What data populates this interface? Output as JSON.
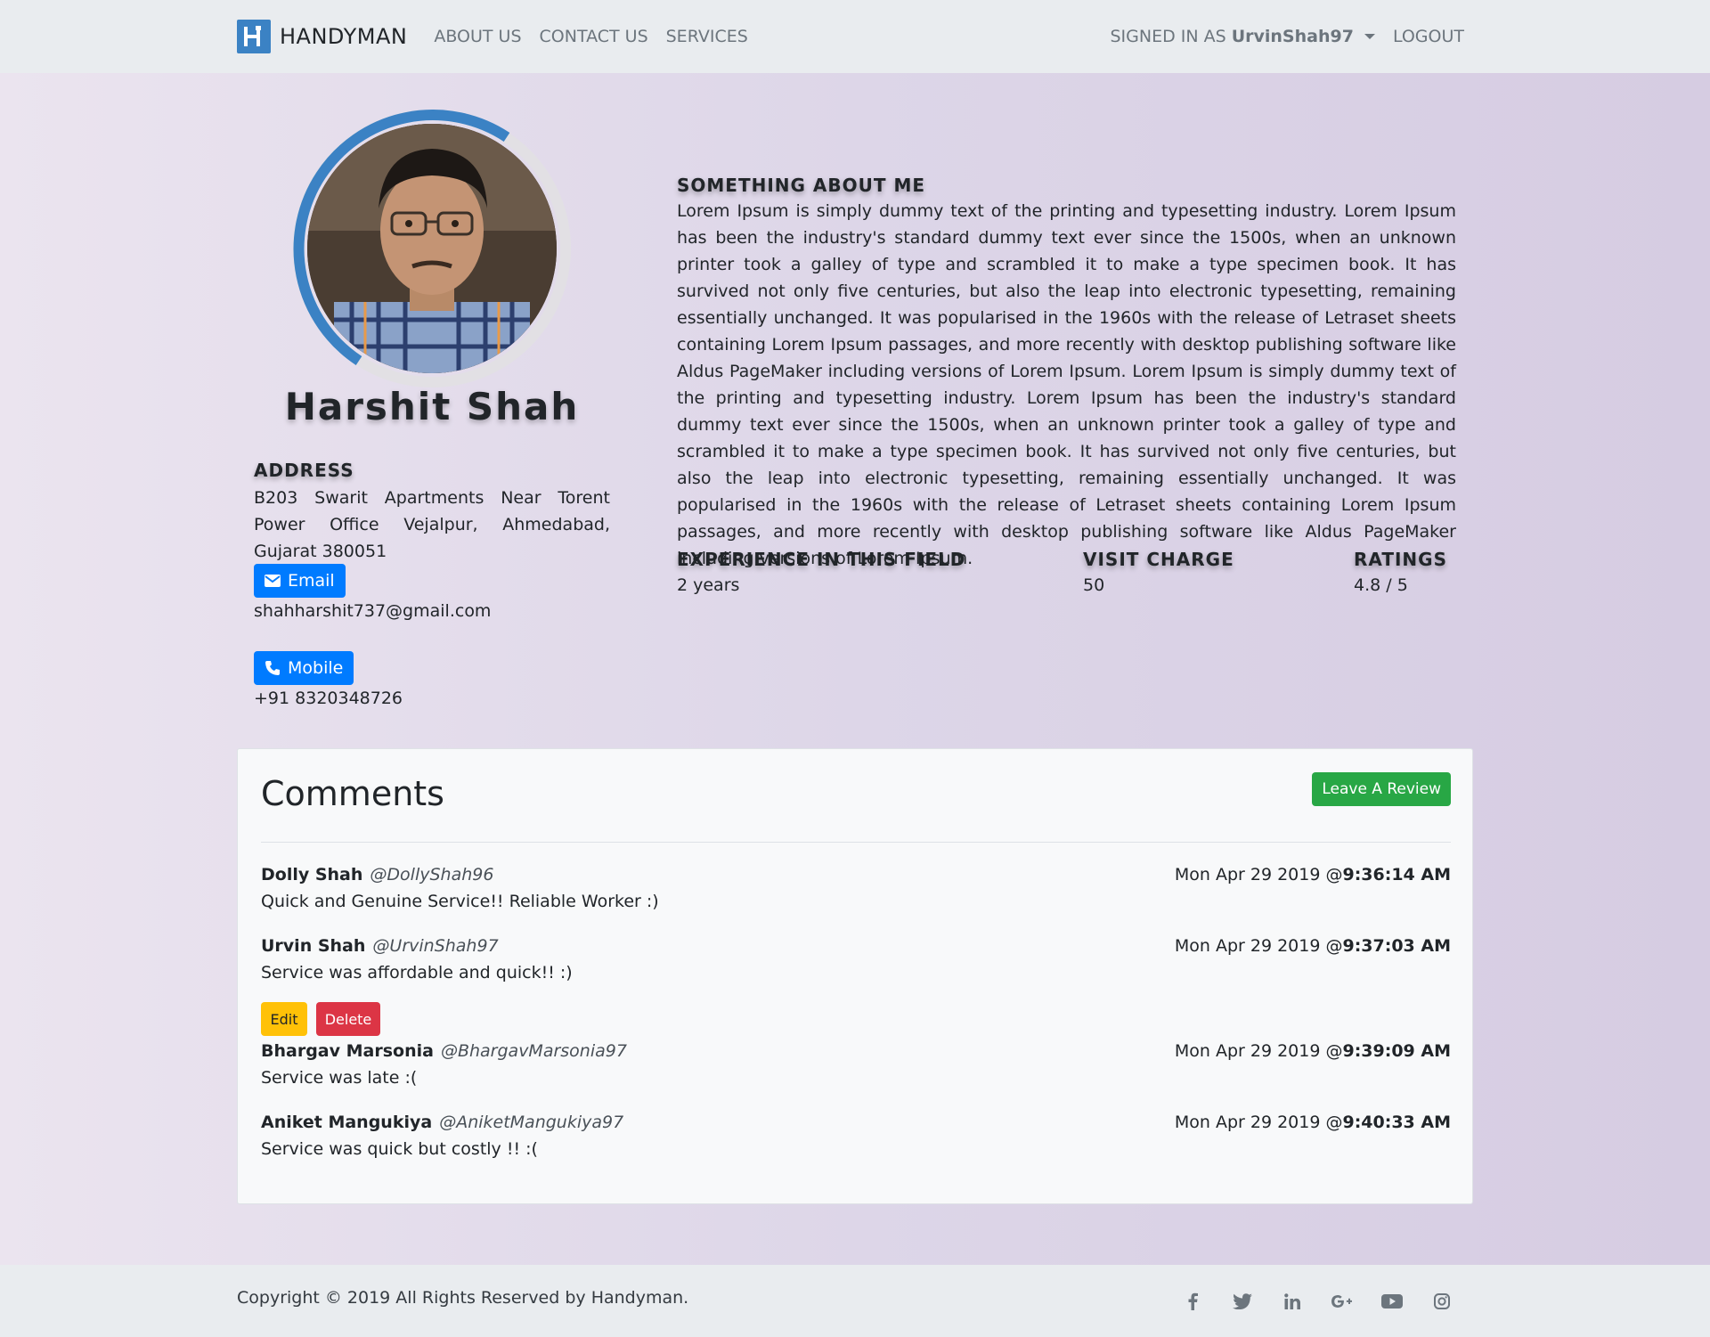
{
  "navbar": {
    "brand": "HANDYMAN",
    "links": [
      "ABOUT US",
      "CONTACT US",
      "SERVICES"
    ],
    "signed_prefix": "SIGNED IN AS",
    "signed_user": "UrvinShah97",
    "logout": "LOGOUT"
  },
  "profile": {
    "name": "Harshit Shah",
    "address_heading": "ADDRESS",
    "address": "B203 Swarit Apartments Near Torent Power Office Vejalpur, Ahmedabad, Gujarat 380051",
    "email_label": "Email",
    "email": "shahharshit737@gmail.com",
    "mobile_label": "Mobile",
    "mobile": "+91 8320348726"
  },
  "about": {
    "heading": "SOMETHING ABOUT ME",
    "text": "Lorem Ipsum is simply dummy text of the printing and typesetting industry. Lorem Ipsum has been the industry's standard dummy text ever since the 1500s, when an unknown printer took a galley of type and scrambled it to make a type specimen book. It has survived not only five centuries, but also the leap into electronic typesetting, remaining essentially unchanged. It was popularised in the 1960s with the release of Letraset sheets containing Lorem Ipsum passages, and more recently with desktop publishing software like Aldus PageMaker including versions of Lorem Ipsum. Lorem Ipsum is simply dummy text of the printing and typesetting industry. Lorem Ipsum has been the industry's standard dummy text ever since the 1500s, when an unknown printer took a galley of type and scrambled it to make a type specimen book. It has survived not only five centuries, but also the leap into electronic typesetting, remaining essentially unchanged. It was popularised in the 1960s with the release of Letraset sheets containing Lorem Ipsum passages, and more recently with desktop publishing software like Aldus PageMaker including versions of Lorem Ipsum."
  },
  "stats": {
    "experience_label": "EXPERIENCE IN THIS FIELD",
    "experience": "2 years",
    "charge_label": "VISIT CHARGE",
    "charge": "50",
    "ratings_label": "RATINGS",
    "ratings": "4.8 / 5"
  },
  "comments": {
    "title": "Comments",
    "leave_review": "Leave A Review",
    "edit": "Edit",
    "delete": "Delete",
    "items": [
      {
        "name": "Dolly Shah",
        "handle": "@DollyShah96",
        "date": "Mon Apr 29 2019 @",
        "time": "9:36:14 AM",
        "text": "Quick and Genuine Service!! Reliable Worker :)"
      },
      {
        "name": "Urvin Shah",
        "handle": "@UrvinShah97",
        "date": "Mon Apr 29 2019 @",
        "time": "9:37:03 AM",
        "text": "Service was affordable and quick!! :)"
      },
      {
        "name": "Bhargav Marsonia",
        "handle": "@BhargavMarsonia97",
        "date": "Mon Apr 29 2019 @",
        "time": "9:39:09 AM",
        "text": "Service was late :("
      },
      {
        "name": "Aniket Mangukiya",
        "handle": "@AniketMangukiya97",
        "date": "Mon Apr 29 2019 @",
        "time": "9:40:33 AM",
        "text": "Service was quick but costly !! :("
      }
    ]
  },
  "footer": {
    "copyright": "Copyright © 2019 All Rights Reserved by Handyman.",
    "socials": [
      "facebook-icon",
      "twitter-icon",
      "linkedin-icon",
      "google-plus-icon",
      "youtube-icon",
      "instagram-icon"
    ]
  },
  "colors": {
    "primary": "#007bff",
    "success": "#28a745",
    "warning": "#ffc107",
    "danger": "#dc3545",
    "ring_accent": "#3b82c4"
  }
}
